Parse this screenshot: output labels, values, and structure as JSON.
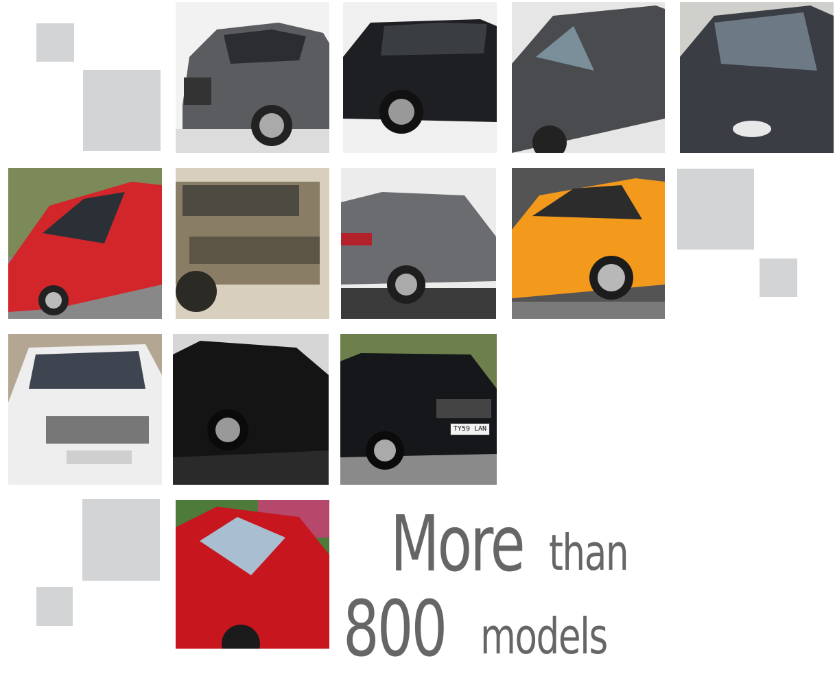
{
  "headline": {
    "word_more": "More",
    "word_than": "than",
    "number": "800",
    "word_models": "models"
  },
  "plate_text": "TY59 LAN",
  "colors": {
    "headline": "#666666",
    "placeholder_square": "#d3d4d6",
    "background": "#ffffff"
  },
  "tiles": [
    {
      "name": "car-audi-q7-grey",
      "color": "#5a5c60"
    },
    {
      "name": "car-range-rover-black",
      "color": "#1e1f22"
    },
    {
      "name": "car-bmw-x3-grey",
      "color": "#4a4b4e"
    },
    {
      "name": "car-vw-bora-dark",
      "color": "#3a3d44"
    },
    {
      "name": "car-opel-astra-red",
      "color": "#d2262a"
    },
    {
      "name": "car-hummer-tan",
      "color": "#8a7d66"
    },
    {
      "name": "car-audi-q7-rear",
      "color": "#6b6c70"
    },
    {
      "name": "car-lotus-elise-orange",
      "color": "#f39a1c"
    },
    {
      "name": "car-mercedes-white",
      "color": "#eeeeee"
    },
    {
      "name": "car-mercedes-e-black",
      "color": "#141414"
    },
    {
      "name": "car-toyota-prado-black",
      "color": "#15171a"
    },
    {
      "name": "car-tesla-roadster-red",
      "color": "#c8161f"
    }
  ]
}
